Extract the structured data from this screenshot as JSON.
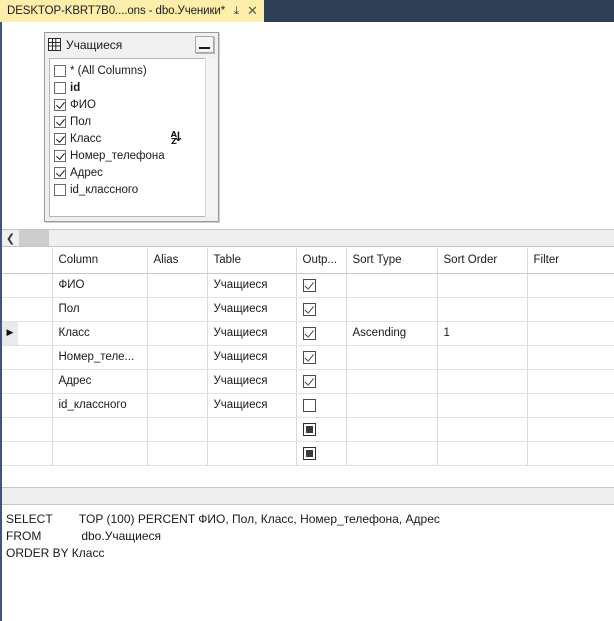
{
  "tab": {
    "title": "DESKTOP-KBRT7B0....ons - dbo.Ученики*",
    "pin_icon": "pin-icon",
    "close_icon": "close-icon",
    "close_glyph": "✕",
    "pin_glyph": "⤓"
  },
  "diagram": {
    "table": {
      "name": "Учащиеся",
      "icon": "table-grid-icon",
      "minimize_label": "",
      "columns": [
        {
          "label": "* (All Columns)",
          "checked": false,
          "primary_key": false,
          "sort_icon": null
        },
        {
          "label": "id",
          "checked": false,
          "primary_key": true,
          "sort_icon": null
        },
        {
          "label": "ФИО",
          "checked": true,
          "primary_key": false,
          "sort_icon": null
        },
        {
          "label": "Пол",
          "checked": true,
          "primary_key": false,
          "sort_icon": null
        },
        {
          "label": "Класс",
          "checked": true,
          "primary_key": false,
          "sort_icon": "sort-ascending-az-icon"
        },
        {
          "label": "Номер_телефона",
          "checked": true,
          "primary_key": false,
          "sort_icon": null
        },
        {
          "label": "Адрес",
          "checked": true,
          "primary_key": false,
          "sort_icon": null
        },
        {
          "label": "id_классного",
          "checked": false,
          "primary_key": false,
          "sort_icon": null
        }
      ]
    },
    "sort_icon_text": "A\nZ",
    "sort_icon_arrow": "↓"
  },
  "scrollbar": {
    "left_arrow_glyph": "❮"
  },
  "grid": {
    "headers": [
      "Column",
      "Alias",
      "Table",
      "Outp...",
      "Sort Type",
      "Sort Order",
      "Filter"
    ],
    "rows": [
      {
        "selected": false,
        "column": "ФИО",
        "alias": "",
        "table": "Учащиеся",
        "output": "checked",
        "sort_type": "",
        "sort_order": "",
        "filter": ""
      },
      {
        "selected": false,
        "column": "Пол",
        "alias": "",
        "table": "Учащиеся",
        "output": "checked",
        "sort_type": "",
        "sort_order": "",
        "filter": ""
      },
      {
        "selected": true,
        "column": "Класс",
        "alias": "",
        "table": "Учащиеся",
        "output": "checked",
        "sort_type": "Ascending",
        "sort_order": "1",
        "filter": ""
      },
      {
        "selected": false,
        "column": "Номер_теле...",
        "alias": "",
        "table": "Учащиеся",
        "output": "checked",
        "sort_type": "",
        "sort_order": "",
        "filter": ""
      },
      {
        "selected": false,
        "column": "Адрес",
        "alias": "",
        "table": "Учащиеся",
        "output": "checked",
        "sort_type": "",
        "sort_order": "",
        "filter": ""
      },
      {
        "selected": false,
        "column": "id_классного",
        "alias": "",
        "table": "Учащиеся",
        "output": "unchecked",
        "sort_type": "",
        "sort_order": "",
        "filter": ""
      },
      {
        "selected": false,
        "column": "",
        "alias": "",
        "table": "",
        "output": "filled",
        "sort_type": "",
        "sort_order": "",
        "filter": ""
      },
      {
        "selected": false,
        "column": "",
        "alias": "",
        "table": "",
        "output": "filled",
        "sort_type": "",
        "sort_order": "",
        "filter": ""
      }
    ],
    "row_marker_glyph": "▶"
  },
  "sql": {
    "lines": [
      "SELECT        TOP (100) PERCENT ФИО, Пол, Класс, Номер_телефона, Адрес",
      "FROM            dbo.Учащиеся",
      "ORDER BY Класс"
    ]
  },
  "colors": {
    "tab_active": "#fdeeab",
    "tabstrip": "#2d3e55",
    "selection": "#e4eaf0",
    "accent_border": "#3b5680"
  }
}
